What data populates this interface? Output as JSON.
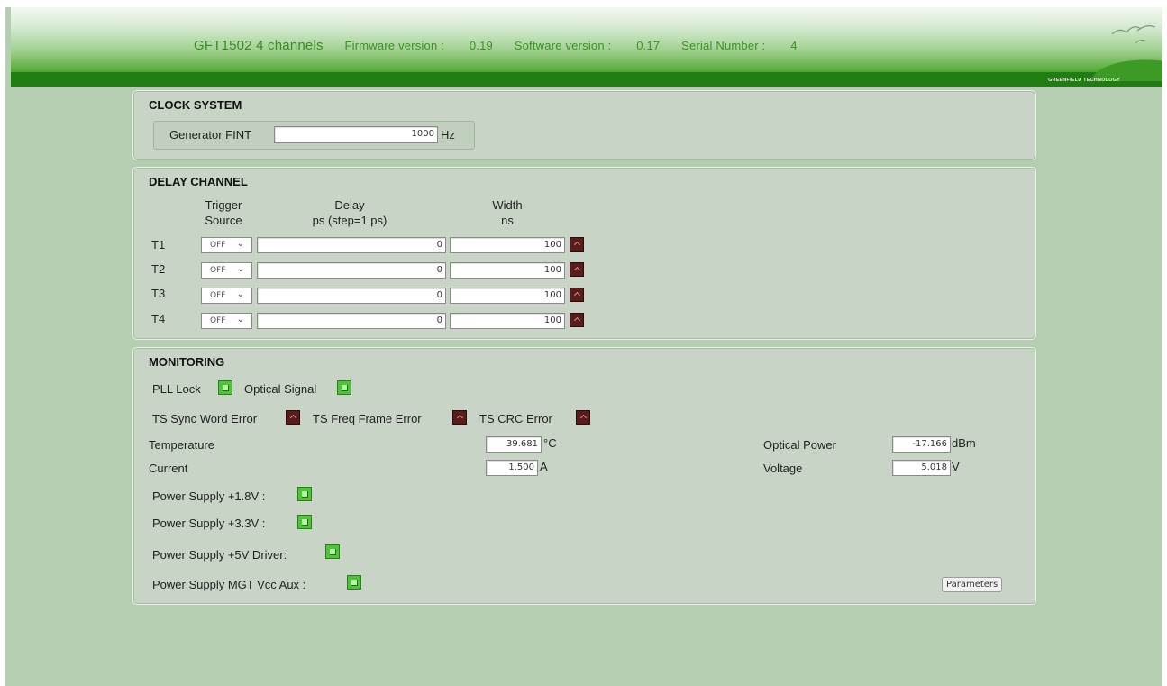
{
  "header": {
    "product": "GFT1502 4 channels",
    "firmware_label": "Firmware version :",
    "firmware_value": "0.19",
    "software_label": "Software version :",
    "software_value": "0.17",
    "serial_label": "Serial Number :",
    "serial_value": "4",
    "logo_text": "GREENFIELD TECHNOLOGY"
  },
  "clock": {
    "title": "CLOCK SYSTEM",
    "generator_label": "Generator FINT",
    "generator_value": "1000",
    "unit": "Hz"
  },
  "delay": {
    "title": "DELAY CHANNEL",
    "col_trigger_1": "Trigger",
    "col_trigger_2": "Source",
    "col_delay_1": "Delay",
    "col_delay_2": "ps (step=1 ps)",
    "col_width_1": "Width",
    "col_width_2": "ns",
    "rows": [
      {
        "label": "T1",
        "source": "OFF",
        "delay": "0",
        "width": "100"
      },
      {
        "label": "T2",
        "source": "OFF",
        "delay": "0",
        "width": "100"
      },
      {
        "label": "T3",
        "source": "OFF",
        "delay": "0",
        "width": "100"
      },
      {
        "label": "T4",
        "source": "OFF",
        "delay": "0",
        "width": "100"
      }
    ]
  },
  "monitoring": {
    "title": "MONITORING",
    "pll_lock": "PLL Lock",
    "optical_signal": "Optical Signal",
    "ts_sync": "TS Sync Word Error",
    "ts_freq": "TS Freq Frame Error",
    "ts_crc": "TS CRC Error",
    "temperature_label": "Temperature",
    "temperature_value": "39.681",
    "temperature_unit": "°C",
    "current_label": "Current",
    "current_value": "1.500",
    "current_unit": "A",
    "optical_power_label": "Optical Power",
    "optical_power_value": "-17.166",
    "optical_power_unit": "dBm",
    "voltage_label": "Voltage",
    "voltage_value": "5.018",
    "voltage_unit": "V",
    "ps_18": "Power Supply +1.8V :",
    "ps_33": "Power Supply +3.3V :",
    "ps_5v": "Power Supply +5V Driver:",
    "ps_mgt": "Power Supply MGT Vcc Aux :",
    "parameters_button": "Parameters"
  },
  "colors": {
    "status_ok": "#4fc23a",
    "status_off": "#5a1b1b",
    "brand_green": "#1f7d12",
    "page_bg": "#b5cdb0"
  }
}
